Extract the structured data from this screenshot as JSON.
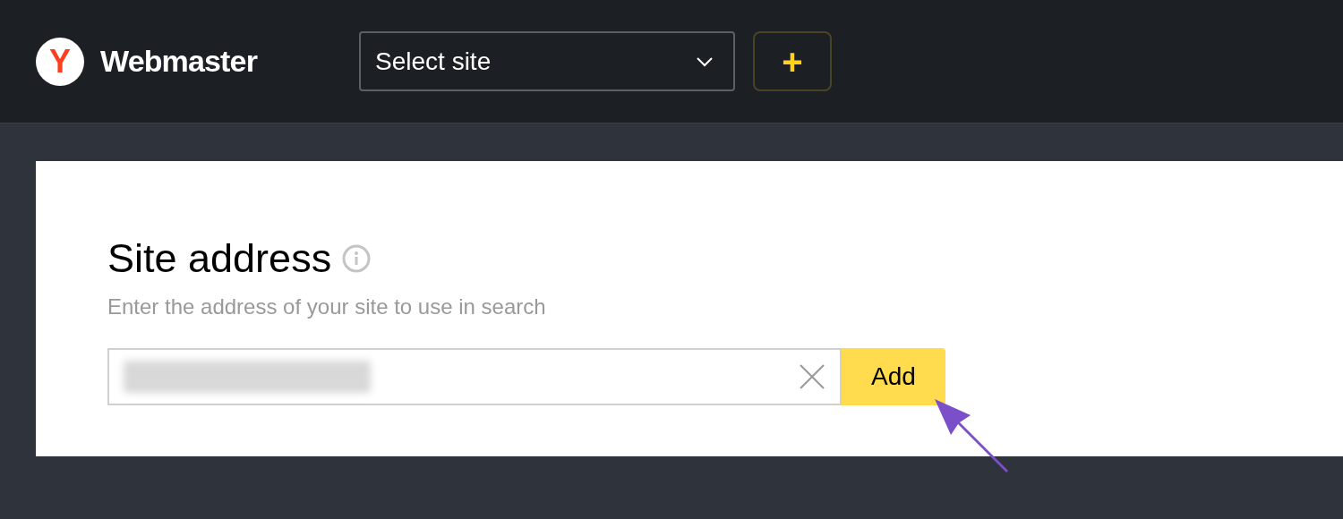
{
  "header": {
    "logo_letter": "Y",
    "app_name": "Webmaster",
    "site_select": {
      "value": "Select site"
    },
    "add_button": {
      "label": "+"
    }
  },
  "card": {
    "title": "Site address",
    "subtitle": "Enter the address of your site to use in search",
    "address_field": {
      "redacted": true
    },
    "submit_button": {
      "label": "Add"
    }
  }
}
